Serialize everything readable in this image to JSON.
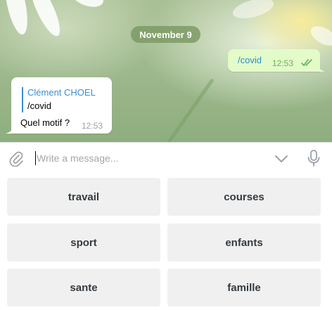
{
  "chat": {
    "date_label": "November 9",
    "messages": [
      {
        "direction": "outgoing",
        "text": "/covid",
        "time": "12:53",
        "status": "read"
      },
      {
        "direction": "incoming",
        "reply_to": {
          "sender": "Clément CHOEL",
          "text": "/covid"
        },
        "text": "Quel motif ?",
        "time": "12:53"
      }
    ]
  },
  "composer": {
    "placeholder": "Write a message...",
    "value": "",
    "icons": [
      "paperclip-icon",
      "chevron-down-icon",
      "microphone-icon"
    ]
  },
  "keyboard": {
    "buttons": [
      [
        "travail",
        "courses"
      ],
      [
        "sport",
        "enfants"
      ],
      [
        "sante",
        "famille"
      ]
    ]
  },
  "colors": {
    "outgoing_bubble": "#e3fbc9",
    "link_blue": "#3a8fd0",
    "read_check": "#5fb256",
    "button_bg": "#f0f0f0",
    "date_pill": "#7d9a63"
  }
}
